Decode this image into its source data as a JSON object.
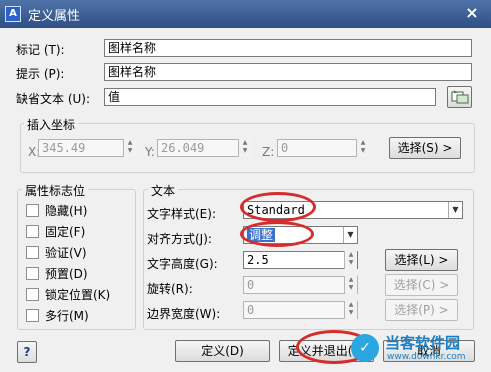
{
  "title": "定义属性",
  "labels": {
    "tag": "标记 (T):",
    "prompt": "提示 (P):",
    "default": "缺省文本 (U):"
  },
  "values": {
    "tag": "图样名称",
    "prompt": "图样名称",
    "default": "值"
  },
  "insert": {
    "title": "插入坐标",
    "x_label": "X:",
    "x_value": "345.49",
    "y_label": "Y:",
    "y_value": "26.049",
    "z_label": "Z:",
    "z_value": "0",
    "select_button": "选择(S) >"
  },
  "flags": {
    "title": "属性标志位",
    "items": [
      "隐藏(H)",
      "固定(F)",
      "验证(V)",
      "预置(D)",
      "锁定位置(K)",
      "多行(M)"
    ]
  },
  "text": {
    "title": "文本",
    "style_label": "文字样式(E):",
    "style_value": "Standard",
    "align_label": "对齐方式(J):",
    "align_value": "调整",
    "height_label": "文字高度(G):",
    "height_value": "2.5",
    "rotate_label": "旋转(R):",
    "rotate_value": "0",
    "width_label": "边界宽度(W):",
    "width_value": "0",
    "select_l": "选择(L) >",
    "select_c": "选择(C) >",
    "select_p": "选择(P) >"
  },
  "bottom": {
    "help": "?",
    "define": "定义(D)",
    "define_exit": "定义并退出(X)",
    "cancel": "取消"
  },
  "watermark": {
    "main": "当客软件园",
    "url": "www.downkr.com"
  },
  "colors": {
    "title_bar": "#3a5b94",
    "highlight_ellipse": "#d72c2c",
    "selection": "#3a6fd0"
  }
}
